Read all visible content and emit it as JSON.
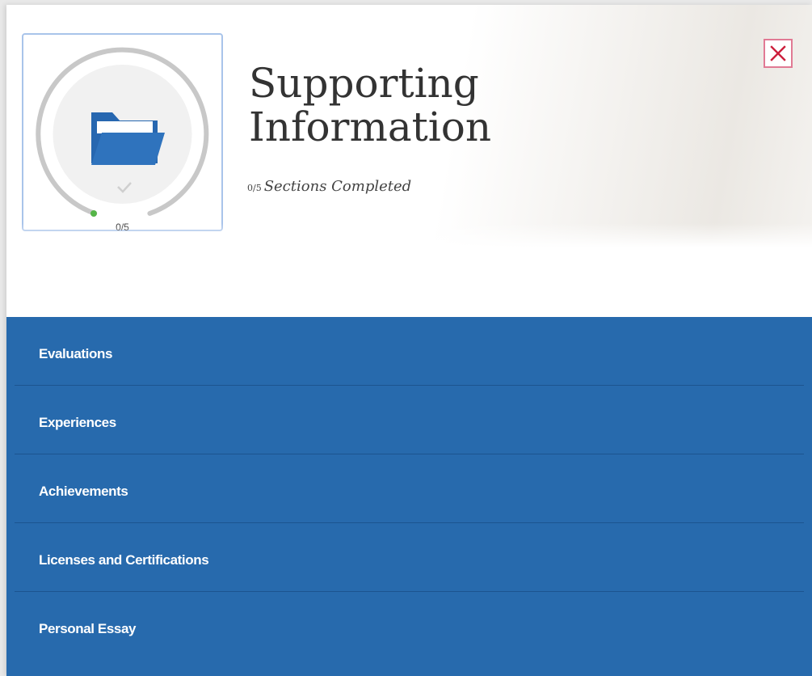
{
  "header": {
    "title_line1": "Supporting",
    "title_line2": "Information",
    "completed_count": "0/5",
    "completed_text": "Sections Completed"
  },
  "progress": {
    "label": "0/5",
    "completed": 0,
    "total": 5,
    "icon": "folder-icon",
    "status_icon": "checkmark-icon"
  },
  "close": {
    "icon": "close-icon",
    "glyph": "×"
  },
  "sections": [
    {
      "label": "Evaluations"
    },
    {
      "label": "Experiences"
    },
    {
      "label": "Achievements"
    },
    {
      "label": "Licenses and Certifications"
    },
    {
      "label": "Personal Essay"
    }
  ],
  "colors": {
    "section_background": "#276aad",
    "accent_blue": "#2767b0",
    "progress_dot": "#55b548",
    "close_border": "#e17a94"
  }
}
